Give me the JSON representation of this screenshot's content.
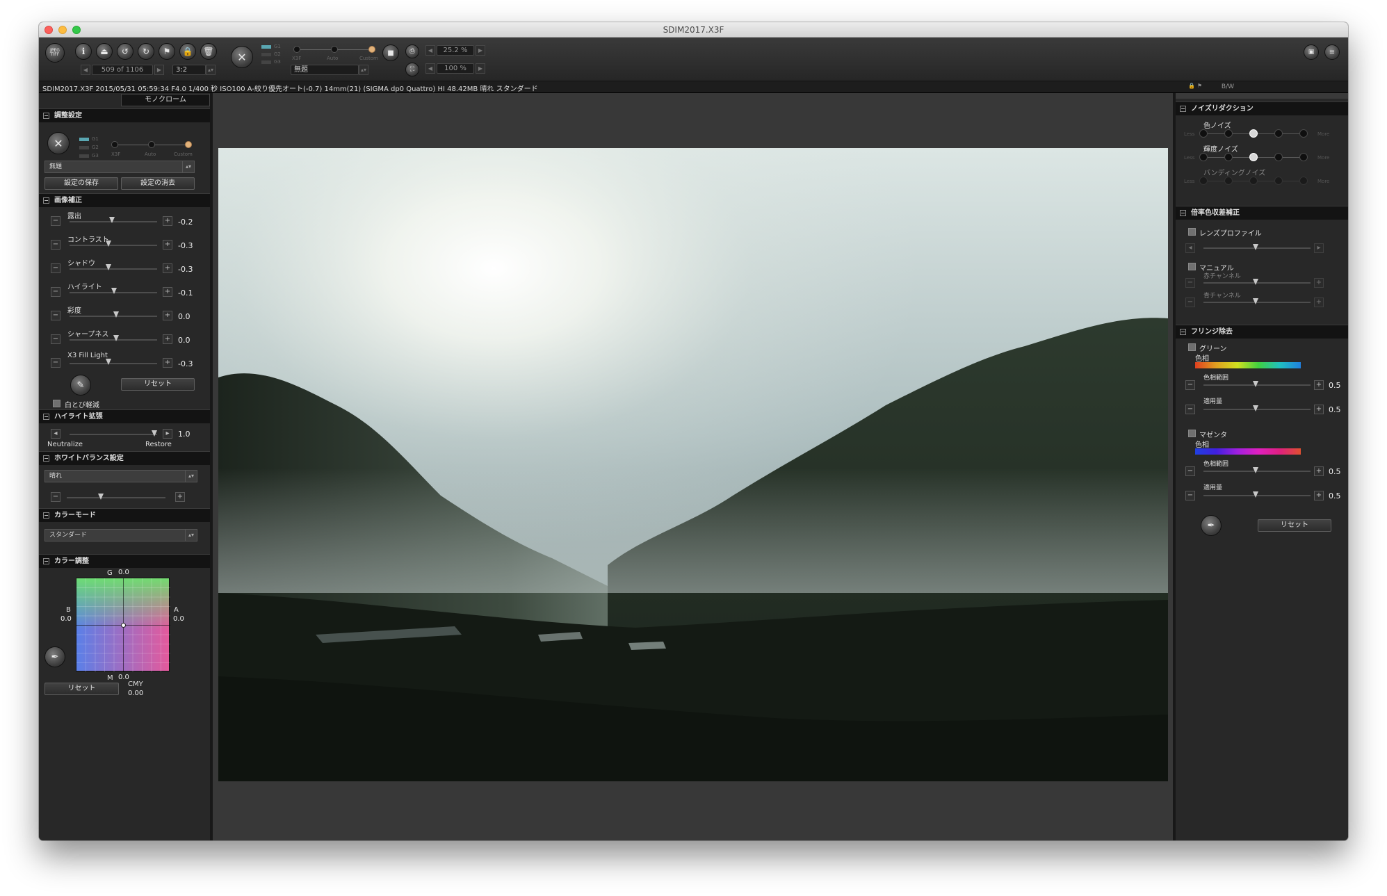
{
  "window": {
    "title": "SDIM2017.X3F"
  },
  "toolbar": {
    "nav_counter": "509 of 1106",
    "aspect": "3:2",
    "zoom1": "25.2 %",
    "zoom2": "100 %",
    "preset_select": "無題",
    "g_labels": [
      "G1",
      "G2",
      "G3"
    ],
    "mode_labels": [
      "X3F",
      "Auto",
      "Custom"
    ],
    "icons": [
      "jpeg-tiff-icon",
      "info-icon",
      "stamp-icon",
      "rotate-left-icon",
      "rotate-right-icon",
      "flag-icon",
      "lock-icon",
      "trash-icon",
      "sigma-logo-icon",
      "stop-icon",
      "print-icon",
      "fullscreen-icon",
      "panel-toggle-icon",
      "menu-icon"
    ]
  },
  "infobar": {
    "text": "SDIM2017.X3F 2015/05/31 05:59:34 F4.0 1/400 秒 ISO100 A-絞り優先オート(-0.7) 14mm(21) (SIGMA dp0 Quattro) HI 48.42MB 晴れ スタンダード",
    "bw": "B/W"
  },
  "left": {
    "tab": "モノクローム",
    "adjust_header": "調整設定",
    "g_labels": [
      "G1",
      "G2",
      "G3"
    ],
    "mode_labels": [
      "X3F",
      "Auto",
      "Custom"
    ],
    "preset_select": "無題",
    "save_btn": "設定の保存",
    "delete_btn": "設定の消去",
    "image_header": "画像補正",
    "sliders": [
      {
        "label": "露出",
        "value": "-0.2",
        "pos": 0.48
      },
      {
        "label": "コントラスト",
        "value": "-0.3",
        "pos": 0.43
      },
      {
        "label": "シャドウ",
        "value": "-0.3",
        "pos": 0.43
      },
      {
        "label": "ハイライト",
        "value": "-0.1",
        "pos": 0.5
      },
      {
        "label": "彩度",
        "value": "0.0",
        "pos": 0.53
      },
      {
        "label": "シャープネス",
        "value": "0.0",
        "pos": 0.53
      },
      {
        "label": "X3 Fill Light",
        "value": "-0.3",
        "pos": 0.43
      }
    ],
    "reset": "リセット",
    "whiteout_label": "白とび軽減",
    "highlight_header": "ハイライト拡張",
    "highlight_value": "1.0",
    "neutralize": "Neutralize",
    "restore": "Restore",
    "wb_header": "ホワイトバランス設定",
    "wb_select": "晴れ",
    "colormode_header": "カラーモード",
    "colormode_select": "スタンダード",
    "color_header": "カラー調整",
    "color_g": "G",
    "color_g_val": "0.0",
    "color_b": "B",
    "color_b_val": "0.0",
    "color_a": "A",
    "color_a_val": "0.0",
    "color_m": "M",
    "color_m_val": "0.0",
    "color_reset": "リセット",
    "cmy_label": "CMY",
    "cmy_val": "0.00"
  },
  "right": {
    "noise_header": "ノイズリダクション",
    "noise": [
      {
        "label": "色ノイズ",
        "active": 2
      },
      {
        "label": "輝度ノイズ",
        "active": 2
      },
      {
        "label": "バンディングノイズ",
        "active": -1
      }
    ],
    "less": "Less",
    "more": "More",
    "chroma_header": "倍率色収差補正",
    "lens_profile": "レンズプロファイル",
    "manual": "マニュアル",
    "red_channel": "赤チャンネル",
    "blue_channel": "青チャンネル",
    "fringe_header": "フリンジ除去",
    "green": "グリーン",
    "hue": "色相",
    "hue_range": "色相範囲",
    "amount": "適用量",
    "green_range_val": "0.5",
    "green_amount_val": "0.5",
    "magenta": "マゼンタ",
    "hue2": "色相",
    "hue_range2": "色相範囲",
    "amount2": "適用量",
    "magenta_range_val": "0.5",
    "magenta_amount_val": "0.5",
    "reset": "リセット"
  },
  "colors": {
    "accent": "#e2b27a",
    "panel": "#282828",
    "header": "#131313",
    "canvas": "#383838"
  }
}
